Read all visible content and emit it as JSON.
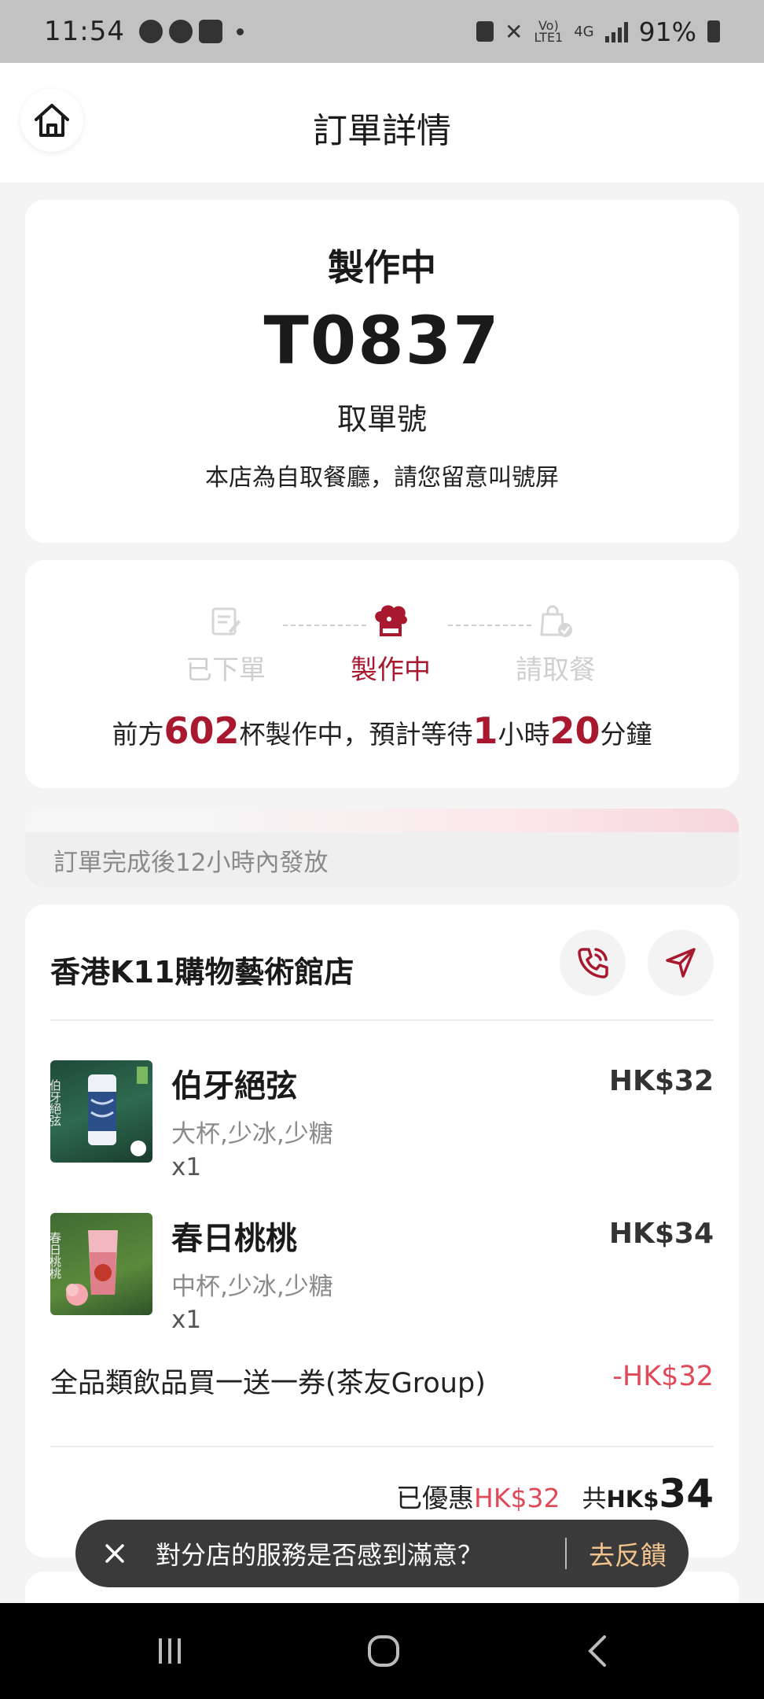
{
  "status_bar": {
    "time": "11:54",
    "network_top": "Vo)",
    "network_bottom": "LTE1",
    "network_type": "4G",
    "battery": "91%"
  },
  "header": {
    "title": "訂單詳情",
    "home_icon": "home-icon"
  },
  "pickup": {
    "status": "製作中",
    "ticket_number": "T0837",
    "ticket_caption": "取單號",
    "notice": "本店為自取餐廳，請您留意叫號屏"
  },
  "progress": {
    "steps": [
      {
        "label": "已下單",
        "icon": "order-placed-icon",
        "state": "done"
      },
      {
        "label": "製作中",
        "icon": "chef-hat-icon",
        "state": "active"
      },
      {
        "label": "請取餐",
        "icon": "pickup-bag-icon",
        "state": "pending"
      }
    ],
    "wait": {
      "prefix": "前方",
      "cups": "602",
      "mid": "杯製作中，預計等待",
      "hours": "1",
      "hour_unit": "小時",
      "minutes": "20",
      "minute_unit": "分鐘"
    }
  },
  "banner": {
    "text": "訂單完成後12小時內發放"
  },
  "order": {
    "store_name": "香港K11購物藝術館店",
    "phone_icon": "phone-icon",
    "navigate_icon": "navigation-arrow-icon",
    "items": [
      {
        "name": "伯牙絕弦",
        "options": "大杯,少冰,少糖",
        "qty": "x1",
        "price": "HK$32",
        "thumb_text": "伯牙絕弦"
      },
      {
        "name": "春日桃桃",
        "options": "中杯,少冰,少糖",
        "qty": "x1",
        "price": "HK$34",
        "thumb_text": "春日桃桃"
      }
    ],
    "coupon": {
      "label": "全品類飲品買一送一券(茶友Group)",
      "amount": "-HK$32"
    },
    "discount_label": "已優惠",
    "discount_amount": "HK$32",
    "total_label": "共",
    "total_currency": "HK$",
    "total_amount": "34"
  },
  "toast": {
    "text": "對分店的服務是否感到滿意？",
    "action": "去反饋"
  },
  "colors": {
    "accent": "#a8182e",
    "discount": "#e04a58",
    "toast_action": "#f2c38c"
  }
}
